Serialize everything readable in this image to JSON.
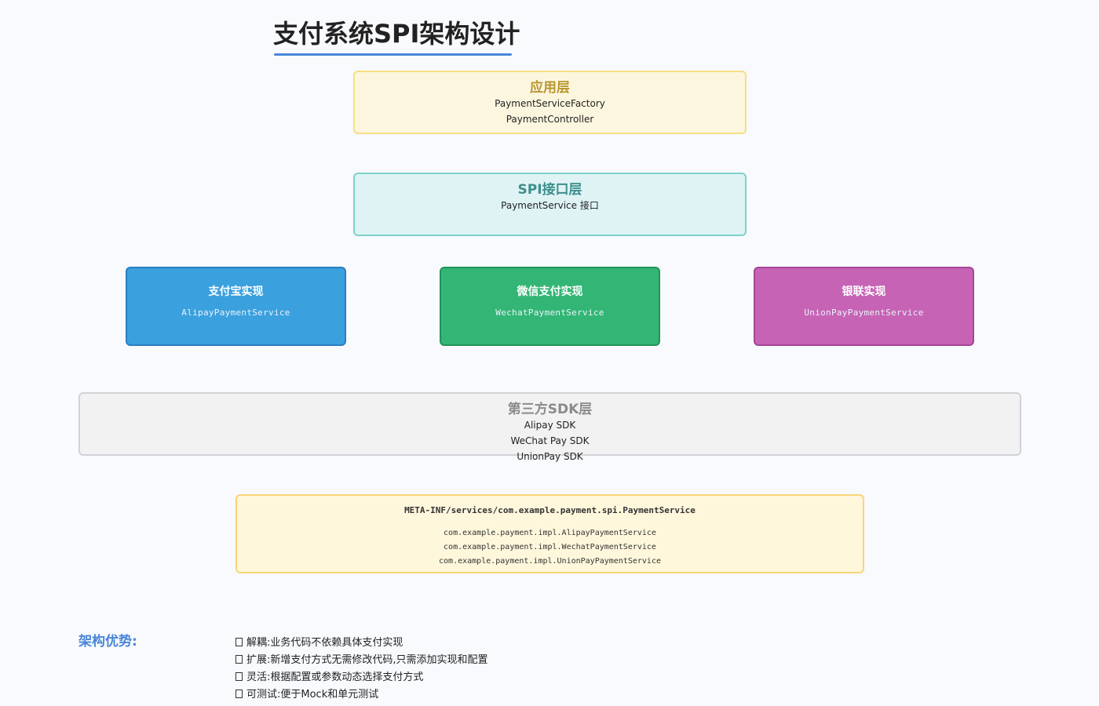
{
  "title": "支付系统SPI架构设计",
  "app_layer": {
    "title": "应用层",
    "items": [
      "PaymentServiceFactory",
      "PaymentController"
    ]
  },
  "spi_layer": {
    "title": "SPI接口层",
    "items": [
      "PaymentService 接口"
    ]
  },
  "implementations": [
    {
      "title": "支付宝实现",
      "class": "AlipayPaymentService",
      "color": "#3ba0de"
    },
    {
      "title": "微信支付实现",
      "class": "WechatPaymentService",
      "color": "#33b675"
    },
    {
      "title": "银联实现",
      "class": "UnionPayPaymentService",
      "color": "#c663b4"
    }
  ],
  "sdk_layer": {
    "title": "第三方SDK层",
    "items": [
      "Alipay SDK",
      "WeChat Pay SDK",
      "UnionPay SDK"
    ]
  },
  "spi_config": {
    "file": "META-INF/services/com.example.payment.spi.PaymentService",
    "lines": [
      "com.example.payment.impl.AlipayPaymentService",
      "com.example.payment.impl.WechatPaymentService",
      "com.example.payment.impl.UnionPayPaymentService"
    ]
  },
  "advantages": {
    "title": "架构优势:",
    "items": [
      "解耦:业务代码不依赖具体支付实现",
      "扩展:新增支付方式无需修改代码,只需添加实现和配置",
      "灵活:根据配置或参数动态选择支付方式",
      "可测试:便于Mock和单元测试"
    ]
  }
}
